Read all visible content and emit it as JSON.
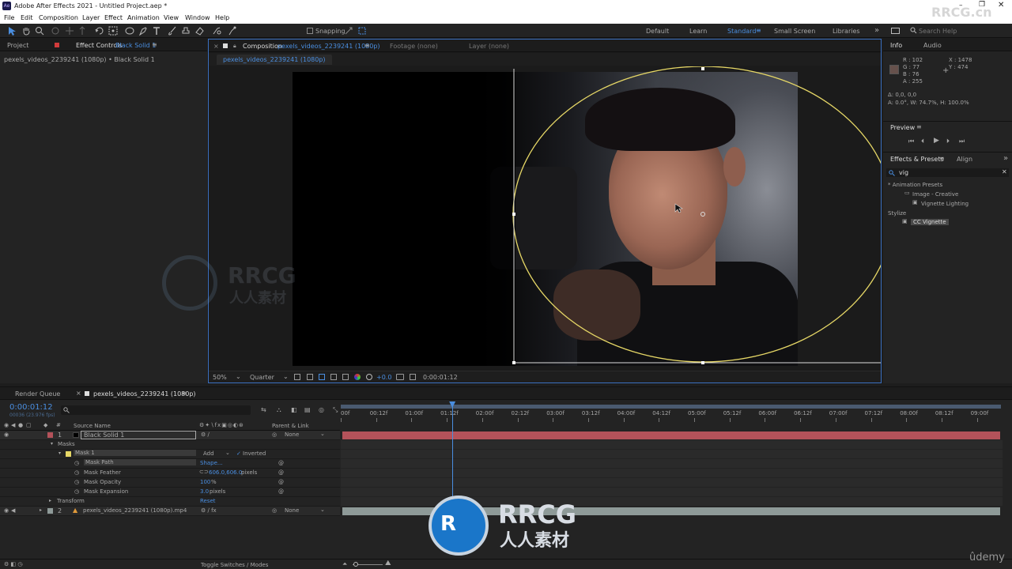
{
  "window": {
    "title": "Adobe After Effects 2021 - Untitled Project.aep *"
  },
  "menu": [
    "File",
    "Edit",
    "Composition",
    "Layer",
    "Effect",
    "Animation",
    "View",
    "Window",
    "Help"
  ],
  "toolbar": {
    "snapping_label": "Snapping",
    "workspaces": [
      "Default",
      "Learn",
      "Standard",
      "Small Screen",
      "Libraries"
    ],
    "active_workspace": "Standard",
    "search_placeholder": "Search Help"
  },
  "left_panel": {
    "tabs": [
      "Project",
      "Effect Controls"
    ],
    "effect_controls_target": "Black Solid 1",
    "breadcrumb": "pexels_videos_2239241 (1080p) • Black Solid 1"
  },
  "comp_panel": {
    "tab_prefix": "Composition",
    "tab_name": "pexels_videos_2239241 (1080p)",
    "footage_tab": "Footage (none)",
    "layer_tab": "Layer (none)",
    "sub_tab": "pexels_videos_2239241 (1080p)",
    "zoom": "50%",
    "resolution": "Quarter",
    "exposure": "+0.0",
    "timecode": "0:00:01:12"
  },
  "info_panel": {
    "tabs": [
      "Info",
      "Audio"
    ],
    "r": "R : 102",
    "g": "G : 77",
    "b": "B : 76",
    "a": "A : 255",
    "x": "X : 1478",
    "y": "Y : 474",
    "delta": "Δ: 0,0, 0,0",
    "detail": "A: 0.0°, W: 74.7%, H: 100.0%",
    "swatch_color": "#66514c"
  },
  "preview_panel": {
    "title": "Preview"
  },
  "effects_panel": {
    "tabs": [
      "Effects & Presets",
      "Align"
    ],
    "search_value": "vig",
    "tree": {
      "animation_presets": "* Animation Presets",
      "image_creative": "Image - Creative",
      "vignette_lighting": "Vignette Lighting",
      "stylize": "Stylize",
      "cc_vignette": "CC Vignette"
    }
  },
  "timeline": {
    "render_queue_tab": "Render Queue",
    "comp_tab": "pexels_videos_2239241 (1080p)",
    "current_time": "0:00:01:12",
    "frame_info": "00036 (23.976 fps)",
    "columns": {
      "source_name": "Source Name",
      "parent": "Parent & Link"
    },
    "ruler": [
      "00f",
      "00:12f",
      "01:00f",
      "01:12f",
      "02:00f",
      "02:12f",
      "03:00f",
      "03:12f",
      "04:00f",
      "04:12f",
      "05:00f",
      "05:12f",
      "06:00f",
      "06:12f",
      "07:00f",
      "07:12f",
      "08:00f",
      "08:12f",
      "09:00f"
    ],
    "layer1": {
      "num": "1",
      "name": "Black Solid 1",
      "parent": "None"
    },
    "masks_label": "Masks",
    "mask1": {
      "name": "Mask 1",
      "mode": "Add",
      "inverted": "Inverted"
    },
    "mask_path": {
      "label": "Mask Path",
      "value": "Shape..."
    },
    "mask_feather": {
      "label": "Mask Feather",
      "value": "606.0,606.0",
      "unit": "pixels"
    },
    "mask_opacity": {
      "label": "Mask Opacity",
      "value": "100",
      "unit": "%"
    },
    "mask_expansion": {
      "label": "Mask Expansion",
      "value": "3.0",
      "unit": "pixels"
    },
    "transform": {
      "label": "Transform",
      "value": "Reset"
    },
    "layer2": {
      "num": "2",
      "name": "pexels_videos_2239241 (1080p).mp4",
      "parent": "None"
    },
    "toggle_label": "Toggle Switches / Modes",
    "playhead_fraction": 0.166,
    "colors": {
      "layer1_bar": "#b4525a",
      "layer2_bar": "#8e9a98",
      "accent": "#4a8ee0"
    }
  },
  "watermarks": {
    "site": "RRCG.cn",
    "brand": "RRCG",
    "brand_cn": "人人素材",
    "udemy": "ûdemy"
  }
}
